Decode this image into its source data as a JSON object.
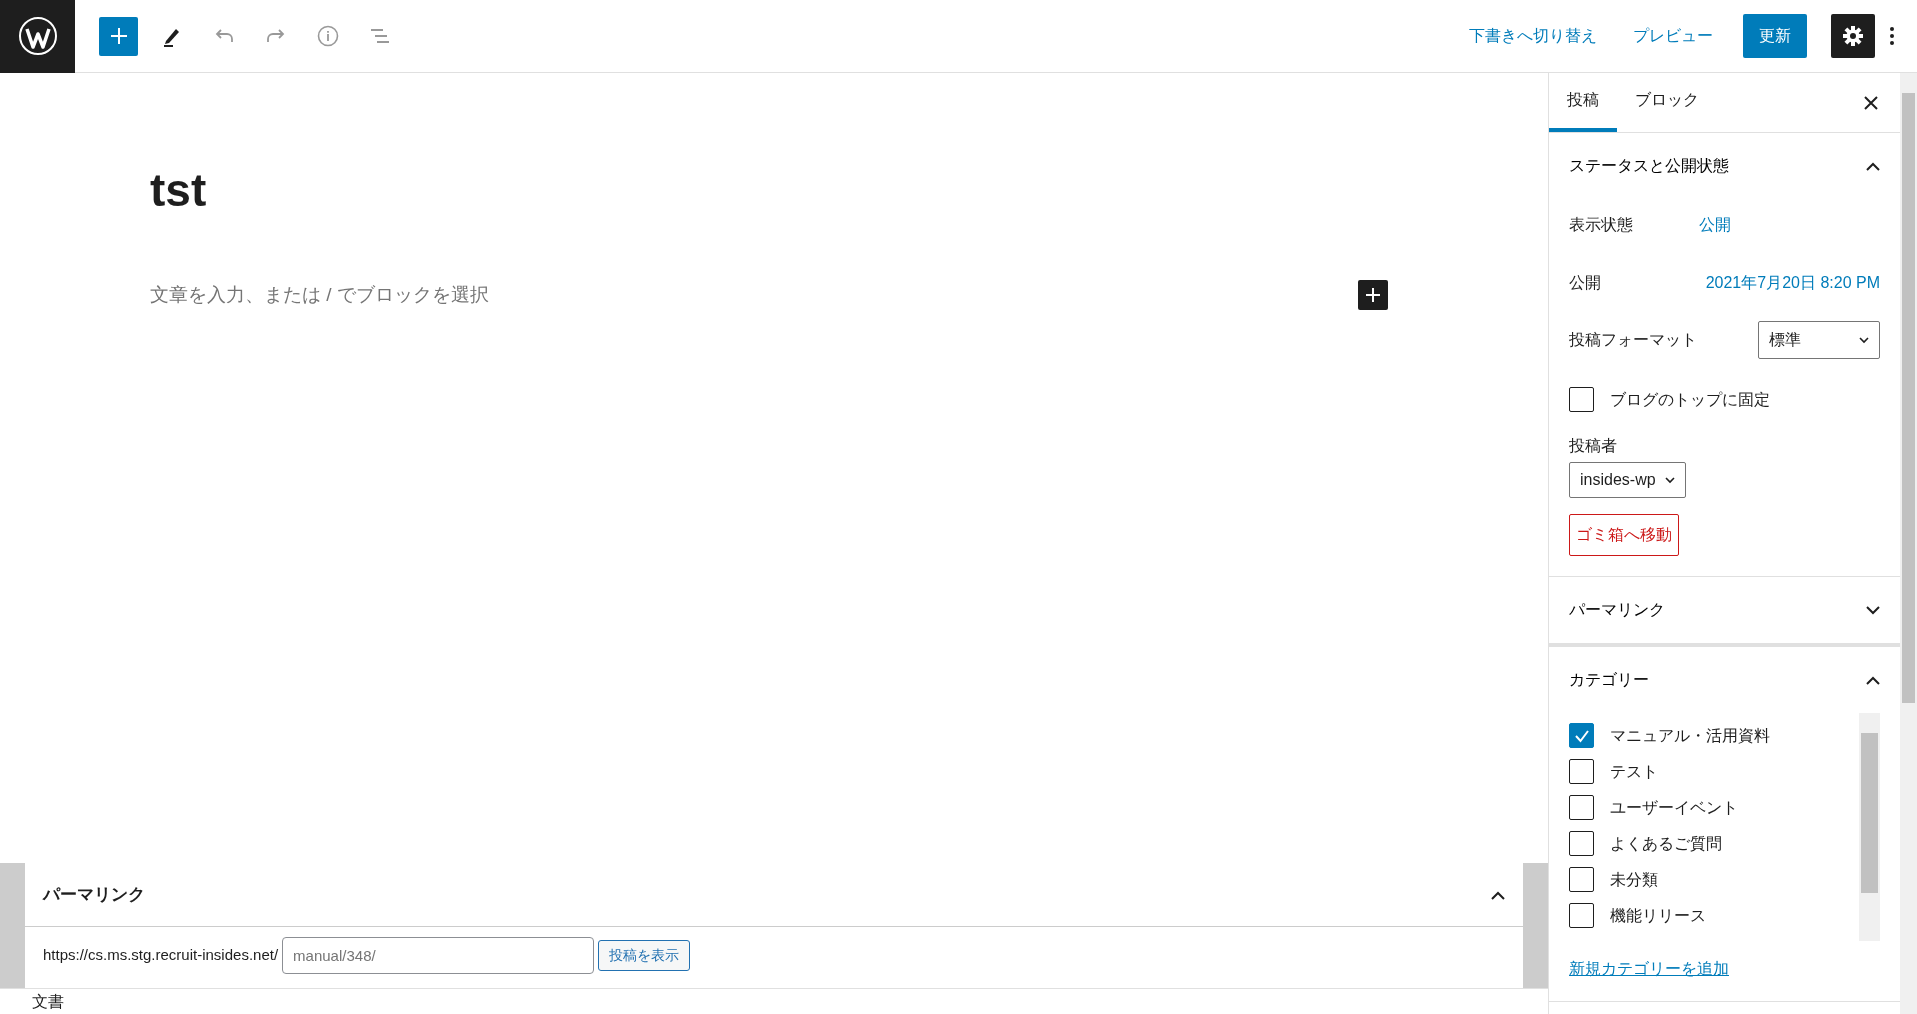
{
  "toolbar": {
    "settings_active": true,
    "switch_draft": "下書きへ切り替え",
    "preview": "プレビュー",
    "update": "更新"
  },
  "editor": {
    "title": "tst",
    "placeholder": "文章を入力、または / でブロックを選択"
  },
  "sidebar": {
    "tabs": [
      {
        "label": "投稿",
        "selected": true
      },
      {
        "label": "ブロック",
        "selected": false
      }
    ],
    "status_panel": {
      "title": "ステータスと公開状態",
      "expanded": true,
      "visibility_label": "表示状態",
      "visibility_value": "公開",
      "publish_label": "公開",
      "publish_value": "2021年7月20日 8:20 PM",
      "format_label": "投稿フォーマット",
      "format_value": "標準",
      "sticky_label": "ブログのトップに固定",
      "sticky_checked": false,
      "author_label": "投稿者",
      "author_value": "insides-wp",
      "trash_button": "ゴミ箱へ移動"
    },
    "permalink_panel": {
      "title": "パーマリンク",
      "expanded": false
    },
    "categories_panel": {
      "title": "カテゴリー",
      "expanded": true,
      "items": [
        {
          "label": "マニュアル・活用資料",
          "checked": true
        },
        {
          "label": "テスト",
          "checked": false
        },
        {
          "label": "ユーザーイベント",
          "checked": false
        },
        {
          "label": "よくあるご質問",
          "checked": false
        },
        {
          "label": "未分類",
          "checked": false
        },
        {
          "label": "機能リリース",
          "checked": false
        }
      ],
      "add_link": "新規カテゴリーを追加"
    }
  },
  "metabox": {
    "title": "パーマリンク",
    "expanded": true,
    "base_url": "https://cs.ms.stg.recruit-insides.net/",
    "slug_placeholder": "manual/348/",
    "view_button": "投稿を表示"
  },
  "footer": {
    "breadcrumb": "文書"
  }
}
